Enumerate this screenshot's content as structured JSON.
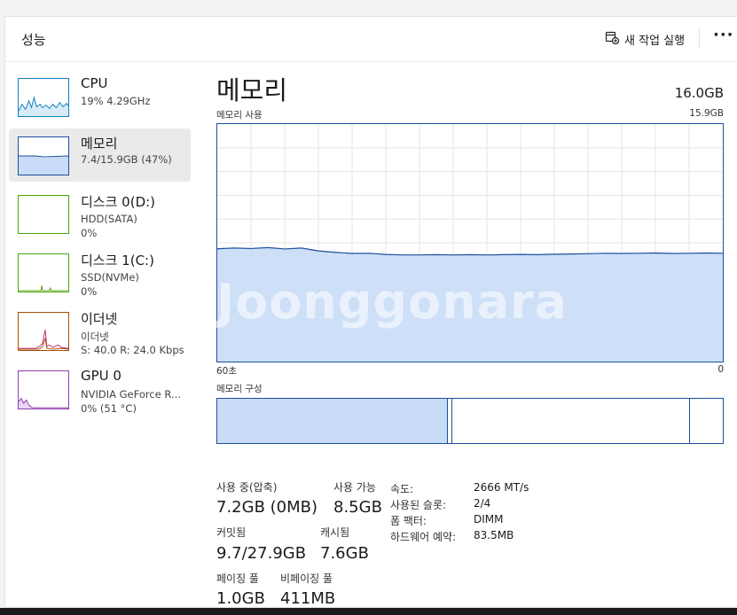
{
  "header": {
    "title": "성능",
    "run_task_label": "새 작업 실행",
    "more_label": "···"
  },
  "sidebar": {
    "items": [
      {
        "name": "CPU",
        "line1": "19% 4.29GHz",
        "line2": "",
        "color": "#117dbb"
      },
      {
        "name": "메모리",
        "line1": "7.4/15.9GB (47%)",
        "line2": "",
        "color": "#1c4e9e"
      },
      {
        "name": "디스크 0(D:)",
        "line1": "HDD(SATA)",
        "line2": "0%",
        "color": "#4da60c"
      },
      {
        "name": "디스크 1(C:)",
        "line1": "SSD(NVMe)",
        "line2": "0%",
        "color": "#4da60c"
      },
      {
        "name": "이더넷",
        "line1": "이더넷",
        "line2": "S: 40.0  R: 24.0 Kbps",
        "color": "#a74f01"
      },
      {
        "name": "GPU 0",
        "line1": "NVIDIA GeForce R...",
        "line2": "0% (51 °C)",
        "color": "#8e3cb0"
      }
    ]
  },
  "main": {
    "title": "메모리",
    "total": "16.0GB",
    "usage_label": "메모리 사용",
    "usage_max": "15.9GB",
    "time_left": "60초",
    "time_right": "0",
    "composition_label": "메모리 구성",
    "watermark": "Joonggonara",
    "usage_history_pct": [
      47.5,
      47.8,
      47.6,
      48.0,
      47.4,
      47.8,
      46.6,
      46.0,
      45.5,
      45.6,
      45.1,
      44.9,
      44.9,
      45.0,
      44.9,
      45.0,
      44.9,
      45.0,
      45.1,
      45.0,
      45.2,
      45.3,
      45.4,
      45.6,
      45.5,
      45.6,
      45.7,
      45.5,
      45.6,
      45.7,
      45.6
    ],
    "composition": {
      "in_use_fraction": 0.457,
      "modified_fraction": 0.008,
      "standby_fraction": 0.47,
      "free_fraction": 0.065
    }
  },
  "stats": {
    "in_use_label": "사용 중(압축)",
    "in_use_value": "7.2GB (0MB)",
    "available_label": "사용 가능",
    "available_value": "8.5GB",
    "committed_label": "커밋됨",
    "committed_value": "9.7/27.9GB",
    "cached_label": "캐시됨",
    "cached_value": "7.6GB",
    "paged_label": "페이징 풀",
    "paged_value": "1.0GB",
    "nonpaged_label": "비페이징 풀",
    "nonpaged_value": "411MB"
  },
  "details": [
    {
      "key": "속도:",
      "value": "2666 MT/s"
    },
    {
      "key": "사용된 슬롯:",
      "value": "2/4"
    },
    {
      "key": "폼 팩터:",
      "value": "DIMM"
    },
    {
      "key": "하드웨어 예약:",
      "value": "83.5MB"
    }
  ],
  "colors": {
    "memory_line": "#1c4e9e",
    "memory_fill": "#c9dcf7",
    "grid": "#e6e6e6"
  }
}
